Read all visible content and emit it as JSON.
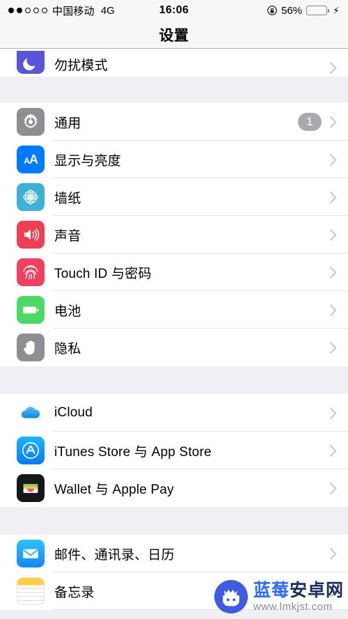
{
  "status_bar": {
    "signal_dots_filled": 2,
    "signal_dots_total": 5,
    "carrier": "中国移动",
    "network": "4G",
    "time": "16:06",
    "rotation_lock_icon": "rotation-lock-icon",
    "battery_percent": "56%",
    "battery_fill": 56,
    "battery_color": "#FFCC00",
    "charging_bolt": "⚡"
  },
  "navbar": {
    "title": "设置"
  },
  "groups": [
    {
      "id": "group-clipped",
      "clipped_top": true,
      "rows": [
        {
          "icon": "do-not-disturb-icon",
          "icon_class": "ic-dnd",
          "label": "勿扰模式",
          "badge": null
        }
      ]
    },
    {
      "id": "group-device",
      "rows": [
        {
          "icon": "gear-icon",
          "icon_class": "ic-gear",
          "label": "通用",
          "badge": "1"
        },
        {
          "icon": "display-brightness-icon",
          "icon_class": "ic-display",
          "label": "显示与亮度",
          "badge": null
        },
        {
          "icon": "wallpaper-icon",
          "icon_class": "ic-wall",
          "label": "墙纸",
          "badge": null
        },
        {
          "icon": "sound-icon",
          "icon_class": "ic-sound",
          "label": "声音",
          "badge": null
        },
        {
          "icon": "touch-id-icon",
          "icon_class": "ic-touch",
          "label": "Touch ID 与密码",
          "badge": null
        },
        {
          "icon": "battery-icon",
          "icon_class": "ic-batt",
          "label": "电池",
          "badge": null
        },
        {
          "icon": "privacy-hand-icon",
          "icon_class": "ic-priv",
          "label": "隐私",
          "badge": null
        }
      ]
    },
    {
      "id": "group-accounts",
      "rows": [
        {
          "icon": "icloud-icon",
          "icon_class": "ic-icloud",
          "label": "iCloud",
          "badge": null
        },
        {
          "icon": "app-store-icon",
          "icon_class": "ic-appstore",
          "label": "iTunes Store 与 App Store",
          "badge": null
        },
        {
          "icon": "wallet-icon",
          "icon_class": "ic-wallet",
          "label": "Wallet 与 Apple Pay",
          "badge": null
        }
      ]
    },
    {
      "id": "group-apps",
      "rows": [
        {
          "icon": "mail-icon",
          "icon_class": "ic-mail",
          "label": "邮件、通讯录、日历",
          "badge": null
        },
        {
          "icon": "notes-icon",
          "icon_class": "ic-notes",
          "label": "备忘录",
          "badge": null
        }
      ]
    }
  ],
  "watermark": {
    "logo": "android-robot-logo",
    "brand_part1": "蓝莓",
    "brand_part2": "安卓网",
    "url": "www.lmkjst.com",
    "brand_color_1": "#2F6BFF",
    "brand_color_2": "#1A2B5E"
  }
}
